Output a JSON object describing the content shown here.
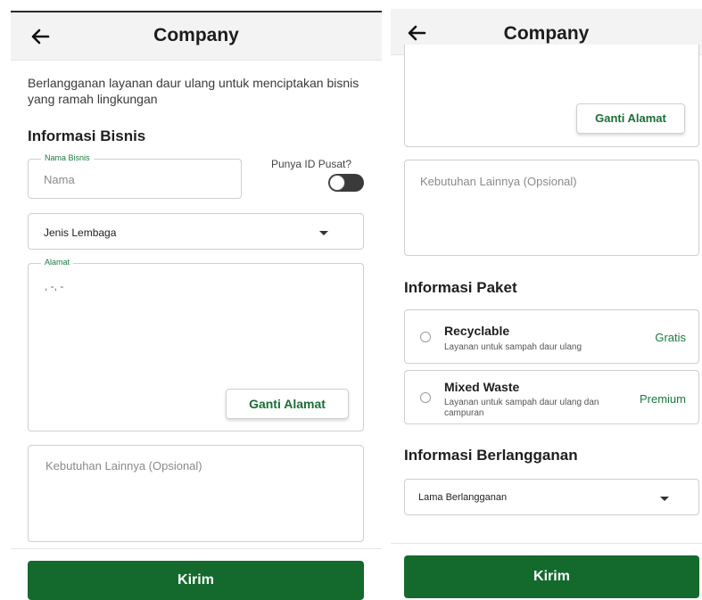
{
  "left": {
    "header": {
      "title": "Company"
    },
    "description": "Berlangganan layanan daur ulang untuk menciptakan bisnis yang ramah lingkungan",
    "section_business": "Informasi Bisnis",
    "business_name": {
      "legend": "Nama Bisnis",
      "placeholder": "Nama"
    },
    "head_office": {
      "label": "Punya ID Pusat?",
      "enabled": false
    },
    "institution_type": {
      "value": "Jenis Lembaga"
    },
    "address": {
      "legend": "Alamat",
      "value": ", -, -"
    },
    "change_address_label": "Ganti Alamat",
    "other_needs_placeholder": "Kebutuhan Lainnya (Opsional)",
    "submit_label": "Kirim"
  },
  "right": {
    "header": {
      "title": "Company"
    },
    "change_address_label": "Ganti Alamat",
    "other_needs_placeholder": "Kebutuhan Lainnya (Opsional)",
    "section_package": "Informasi Paket",
    "packages": [
      {
        "name": "Recyclable",
        "description": "Layanan untuk sampah daur ulang",
        "tag": "Gratis"
      },
      {
        "name": "Mixed Waste",
        "description": "Layanan untuk sampah daur ulang dan campuran",
        "tag": "Premium"
      }
    ],
    "section_subscription": "Informasi Berlangganan",
    "duration": {
      "value": "Lama Berlangganan"
    },
    "submit_label": "Kirim"
  },
  "colors": {
    "accent": "#146a2d",
    "accent_text": "#1b7a3e",
    "appbar": "#f3f3f3"
  },
  "icons": {
    "back": "arrow-left-icon",
    "dropdown": "caret-down-icon",
    "toggle": "toggle-off"
  }
}
